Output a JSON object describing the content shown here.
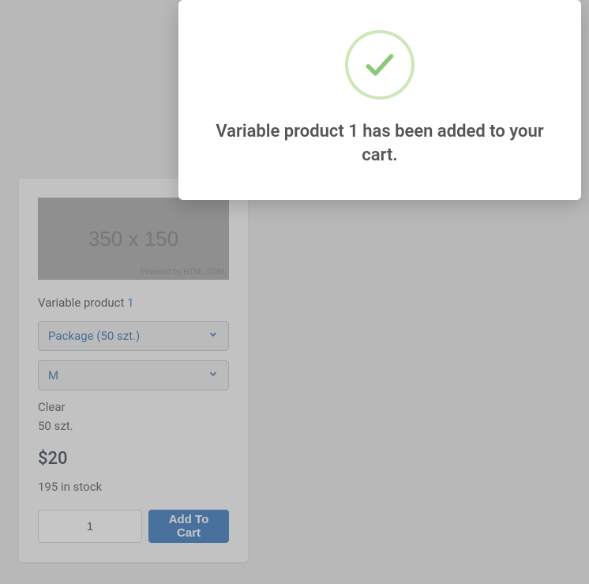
{
  "modal": {
    "message": "Variable product 1 has been added to your cart."
  },
  "product": {
    "image_label": "350 x 150",
    "image_credit": "Powered by HTML.COM",
    "title_prefix": "Variable product ",
    "title_number": "1",
    "select_package": "Package (50 szt.)",
    "select_size": "M",
    "clear_label": "Clear",
    "package_line": "50 szt.",
    "price": "$20",
    "stock": "195 in stock",
    "qty_value": "1",
    "add_label": "Add To Cart"
  }
}
